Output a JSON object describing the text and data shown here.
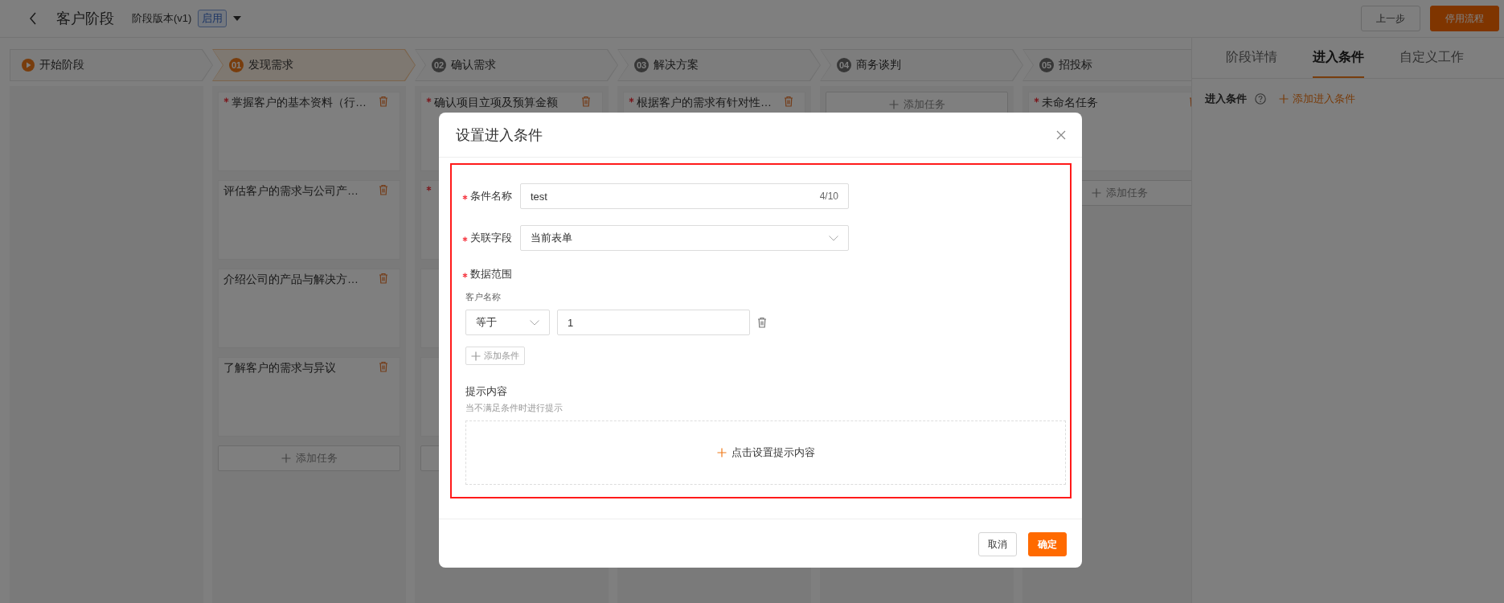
{
  "header": {
    "title": "客户阶段",
    "version": "阶段版本(v1)",
    "status_tag": "启用",
    "buttons": [
      {
        "label": "上一步",
        "kind": "default"
      },
      {
        "label": "停用流程",
        "kind": "primary"
      }
    ]
  },
  "stages": [
    {
      "kind": "start",
      "label": "开始阶段",
      "selected": false
    },
    {
      "kind": "numbered",
      "number": "01",
      "label": "发现需求",
      "selected": true,
      "tasks": [
        {
          "text": "掌握客户的基本资料（行…",
          "required": true
        },
        {
          "text": "评估客户的需求与公司产…",
          "required": false
        },
        {
          "text": "介绍公司的产品与解决方…",
          "required": false
        },
        {
          "text": "了解客户的需求与异议",
          "required": false
        }
      ],
      "add_task": true,
      "add_task_label": "添加任务"
    },
    {
      "kind": "numbered",
      "number": "02",
      "label": "确认需求",
      "selected": false,
      "tasks": [
        {
          "text": "确认项目立项及预算金额",
          "required": true
        },
        {
          "required": true
        },
        {
          "required": false
        },
        {
          "required": false
        }
      ],
      "add_task": true
    },
    {
      "kind": "numbered",
      "number": "03",
      "label": "解决方案",
      "selected": false,
      "tasks": [
        {
          "text": "根据客户的需求有针对性…",
          "required": true
        }
      ]
    },
    {
      "kind": "numbered",
      "number": "04",
      "label": "商务谈判",
      "selected": false,
      "add_task": true,
      "add_task_label": "添加任务"
    },
    {
      "kind": "numbered",
      "number": "05",
      "label": "招投标",
      "selected": false,
      "tasks": [
        {
          "text": "未命名任务",
          "required": true
        }
      ],
      "add_task": true,
      "add_task_label": "添加任务"
    }
  ],
  "side_panel": {
    "tabs": [
      {
        "label": "阶段详情",
        "selected": false
      },
      {
        "label": "进入条件",
        "selected": true
      },
      {
        "label": "自定义工作",
        "selected": false
      }
    ],
    "section_title": "进入条件",
    "add_link": "添加进入条件"
  },
  "dialog": {
    "title": "设置进入条件",
    "highlighted": true,
    "fields": [
      {
        "kind": "text",
        "label": "条件名称",
        "required": true,
        "value": "test",
        "counter": "4/10"
      },
      {
        "kind": "select",
        "label": "关联字段",
        "required": true,
        "value": "当前表单"
      }
    ],
    "data_range": {
      "label": "数据范围",
      "required": true,
      "field_label": "客户名称",
      "conditions": [
        {
          "operator": "等于",
          "value": "1"
        }
      ],
      "add_label": "添加条件"
    },
    "hint": {
      "title": "提示内容",
      "subtitle": "当不满足条件时进行提示",
      "action": "点击设置提示内容"
    },
    "buttons": [
      {
        "label": "取消",
        "kind": "default"
      },
      {
        "label": "确定",
        "kind": "primary"
      }
    ]
  }
}
